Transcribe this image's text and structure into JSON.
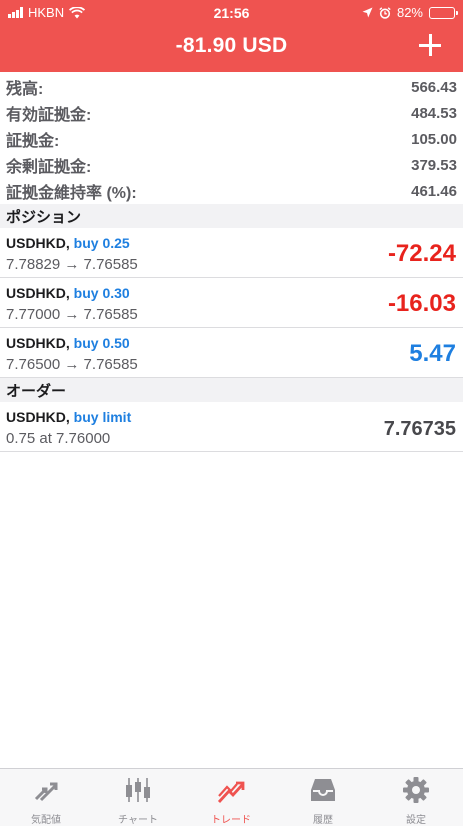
{
  "status_bar": {
    "carrier": "HKBN",
    "time": "21:56",
    "battery": "82%",
    "battery_level": 0.82
  },
  "header": {
    "title": "-81.90 USD"
  },
  "summary": [
    {
      "label": "残高:",
      "value": "566.43"
    },
    {
      "label": "有効証拠金:",
      "value": "484.53"
    },
    {
      "label": "証拠金:",
      "value": "105.00"
    },
    {
      "label": "余剰証拠金:",
      "value": "379.53"
    },
    {
      "label": "証拠金維持率 (%):",
      "value": "461.46"
    }
  ],
  "positions": {
    "header": "ポジション",
    "items": [
      {
        "symbol": "USDHKD,",
        "side": "buy 0.25",
        "prices": "7.78829 → 7.76585",
        "pl": "-72.24"
      },
      {
        "symbol": "USDHKD,",
        "side": "buy 0.30",
        "prices": "7.77000 → 7.76585",
        "pl": "-16.03"
      },
      {
        "symbol": "USDHKD,",
        "side": "buy 0.50",
        "prices": "7.76500 → 7.76585",
        "pl": "5.47"
      }
    ]
  },
  "orders": {
    "header": "オーダー",
    "items": [
      {
        "symbol": "USDHKD,",
        "side": "buy limit",
        "prices": "0.75 at 7.76000",
        "price": "7.76735"
      }
    ]
  },
  "tabs": [
    {
      "label": "気配値",
      "icon": "quotes-arrows-icon"
    },
    {
      "label": "チャート",
      "icon": "candlestick-chart-icon"
    },
    {
      "label": "トレード",
      "icon": "trade-trend-icon",
      "active": true
    },
    {
      "label": "履歴",
      "icon": "history-tray-icon"
    },
    {
      "label": "設定",
      "icon": "gear-icon"
    }
  ],
  "colors": {
    "accent": "#ef5350",
    "loss": "#e8231d",
    "profit": "#1e7fe0",
    "muted": "#8e8e93"
  }
}
